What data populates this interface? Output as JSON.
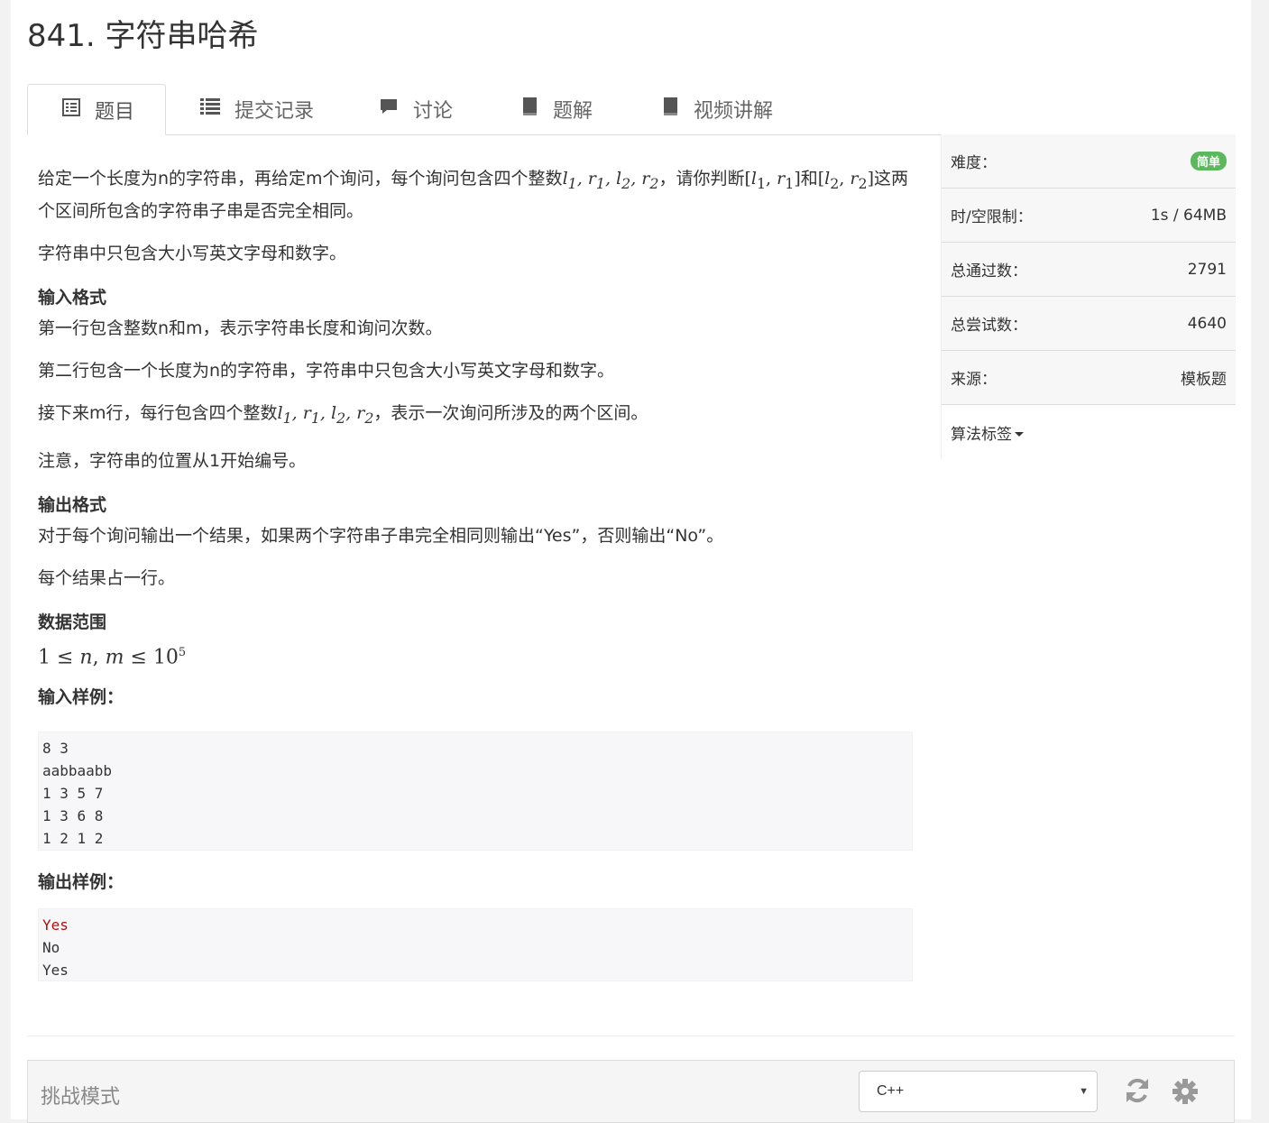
{
  "page": {
    "title": "841. 字符串哈希"
  },
  "tabs": [
    {
      "label": "题目",
      "icon": "list-alt-icon"
    },
    {
      "label": "提交记录",
      "icon": "list-icon"
    },
    {
      "label": "讨论",
      "icon": "comment-icon"
    },
    {
      "label": "题解",
      "icon": "book-icon"
    },
    {
      "label": "视频讲解",
      "icon": "book-icon"
    }
  ],
  "problem": {
    "p1_a": "给定一个长度为n的字符串，再给定m个询问，每个询问包含四个整数",
    "p1_b": "，请你判断",
    "p1_c": "和",
    "p1_d": "这两个区间所包含的字符串子串是否完全相同。",
    "p2": "字符串中只包含大小写英文字母和数字。",
    "input_heading": "输入格式",
    "input_1": "第一行包含整数n和m，表示字符串长度和询问次数。",
    "input_2": "第二行包含一个长度为n的字符串，字符串中只包含大小写英文字母和数字。",
    "input_3a": "接下来m行，每行包含四个整数",
    "input_3b": "，表示一次询问所涉及的两个区间。",
    "input_4": "注意，字符串的位置从1开始编号。",
    "output_heading": "输出格式",
    "output_1": "对于每个询问输出一个结果，如果两个字符串子串完全相同则输出“Yes”，否则输出“No”。",
    "output_2": "每个结果占一行。",
    "range_heading": "数据范围",
    "sample_in_heading": "输入样例：",
    "sample_out_heading": "输出样例："
  },
  "sample_input": [
    "8 3",
    "aabbaabb",
    "1 3 5 7",
    "1 3 6 8",
    "1 2 1 2"
  ],
  "sample_output": [
    "Yes",
    "No",
    "Yes"
  ],
  "sidebar": {
    "difficulty_label": "难度：",
    "difficulty_value": "简单",
    "limit_label": "时/空限制：",
    "limit_value": "1s / 64MB",
    "passed_label": "总通过数：",
    "passed_value": "2791",
    "tried_label": "总尝试数：",
    "tried_value": "4640",
    "source_label": "来源：",
    "source_value": "模板题",
    "tags_label": "算法标签"
  },
  "editor": {
    "mode_label": "挑战模式",
    "language": "C++"
  },
  "colors": {
    "badge_green": "#5cb85c",
    "sample_red": "#a11111"
  }
}
